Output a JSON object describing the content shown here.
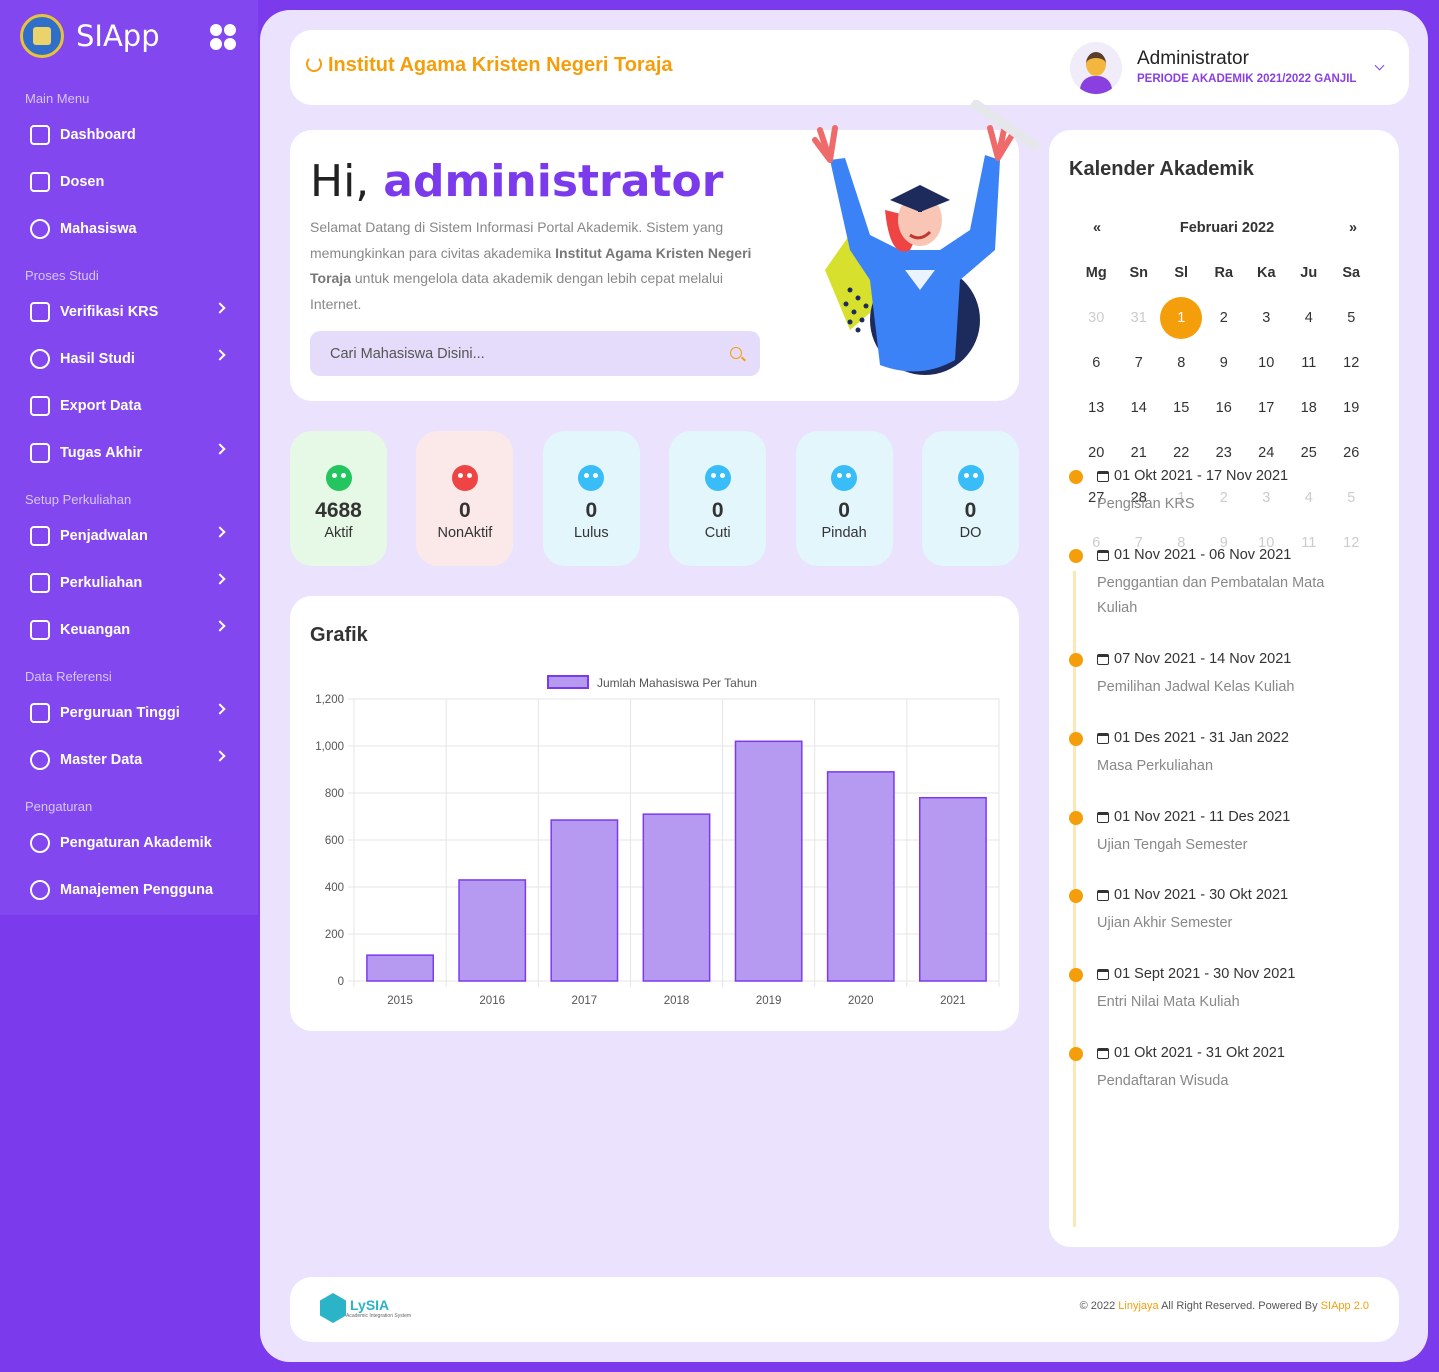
{
  "brand": {
    "name": "SIApp"
  },
  "sidebar": {
    "sections": [
      {
        "label": "Main Menu",
        "items": [
          {
            "label": "Dashboard",
            "arrow": false,
            "icon": "grid-icon"
          },
          {
            "label": "Dosen",
            "arrow": false,
            "icon": "id-card-icon"
          },
          {
            "label": "Mahasiswa",
            "arrow": false,
            "icon": "users-icon"
          }
        ]
      },
      {
        "label": "Proses Studi",
        "items": [
          {
            "label": "Verifikasi KRS",
            "arrow": true,
            "icon": "clipboard-icon"
          },
          {
            "label": "Hasil Studi",
            "arrow": true,
            "icon": "award-icon"
          },
          {
            "label": "Export Data",
            "arrow": false,
            "icon": "excel-icon"
          },
          {
            "label": "Tugas Akhir",
            "arrow": true,
            "icon": "document-icon"
          }
        ]
      },
      {
        "label": "Setup Perkuliahan",
        "items": [
          {
            "label": "Penjadwalan",
            "arrow": true,
            "icon": "calendar-icon"
          },
          {
            "label": "Perkuliahan",
            "arrow": true,
            "icon": "pencil-icon"
          },
          {
            "label": "Keuangan",
            "arrow": true,
            "icon": "wallet-icon"
          }
        ]
      },
      {
        "label": "Data Referensi",
        "items": [
          {
            "label": "Perguruan Tinggi",
            "arrow": true,
            "icon": "building-icon"
          },
          {
            "label": "Master Data",
            "arrow": true,
            "icon": "database-icon"
          }
        ]
      },
      {
        "label": "Pengaturan",
        "items": [
          {
            "label": "Pengaturan Akademik",
            "arrow": false,
            "icon": "gear-icon"
          },
          {
            "label": "Manajemen Pengguna",
            "arrow": false,
            "icon": "user-gear-icon"
          }
        ]
      }
    ]
  },
  "header": {
    "institution": "Institut Agama Kristen Negeri Toraja",
    "user_name": "Administrator",
    "period": "PERIODE AKADEMIK 2021/2022 GANJIL"
  },
  "welcome": {
    "greeting": "Hi, ",
    "name": "administrator",
    "intro_1": "Selamat Datang di Sistem Informasi Portal Akademik. Sistem yang memungkinkan para civitas akademika ",
    "intro_bold": "Institut Agama Kristen Negeri Toraja",
    "intro_2": " untuk mengelola data akademik dengan lebih cepat melalui Internet.",
    "search_placeholder": "Cari Mahasiswa Disini..."
  },
  "stats": [
    {
      "value": "4688",
      "label": "Aktif",
      "bg": "#e6f8e6",
      "icon_color": "#22c55e"
    },
    {
      "value": "0",
      "label": "NonAktif",
      "bg": "#fbe9ea",
      "icon_color": "#ef4444"
    },
    {
      "value": "0",
      "label": "Lulus",
      "bg": "#e3f6fc",
      "icon_color": "#38bdf8"
    },
    {
      "value": "0",
      "label": "Cuti",
      "bg": "#e3f6fc",
      "icon_color": "#38bdf8"
    },
    {
      "value": "0",
      "label": "Pindah",
      "bg": "#e3f6fc",
      "icon_color": "#38bdf8"
    },
    {
      "value": "0",
      "label": "DO",
      "bg": "#e3f6fc",
      "icon_color": "#38bdf8"
    }
  ],
  "grafik": {
    "title": "Grafik"
  },
  "chart_data": {
    "type": "bar",
    "categories": [
      "2015",
      "2016",
      "2017",
      "2018",
      "2019",
      "2020",
      "2021"
    ],
    "series": [
      {
        "name": "Jumlah Mahasiswa Per Tahun",
        "values": [
          110,
          430,
          685,
          710,
          1020,
          890,
          780
        ]
      }
    ],
    "ylim": [
      0,
      1200
    ],
    "yticks": [
      "0",
      "200",
      "400",
      "600",
      "800",
      "1,000",
      "1,200"
    ],
    "grid": true,
    "legend": "top-center",
    "bar_fill": "#b69af2",
    "bar_border": "#7c3aed"
  },
  "calendar": {
    "title": "Kalender Akademik",
    "prev": "«",
    "next": "»",
    "month": "Februari 2022",
    "days_of_week": [
      "Mg",
      "Sn",
      "Sl",
      "Ra",
      "Ka",
      "Ju",
      "Sa"
    ],
    "weeks": [
      [
        "30",
        "31",
        "1",
        "2",
        "3",
        "4",
        "5"
      ],
      [
        "6",
        "7",
        "8",
        "9",
        "10",
        "11",
        "12"
      ],
      [
        "13",
        "14",
        "15",
        "16",
        "17",
        "18",
        "19"
      ],
      [
        "20",
        "21",
        "22",
        "23",
        "24",
        "25",
        "26"
      ],
      [
        "27",
        "28",
        "1",
        "2",
        "3",
        "4",
        "5"
      ],
      [
        "6",
        "7",
        "8",
        "9",
        "10",
        "11",
        "12"
      ]
    ],
    "today": "1"
  },
  "events": [
    {
      "date": "01 Okt 2021 - 17 Nov 2021",
      "desc": "Pengisian KRS"
    },
    {
      "date": "01 Nov 2021 - 06 Nov 2021",
      "desc": "Penggantian dan Pembatalan Mata Kuliah"
    },
    {
      "date": "07 Nov 2021 - 14 Nov 2021",
      "desc": "Pemilihan Jadwal Kelas Kuliah"
    },
    {
      "date": "01 Des 2021 - 31 Jan 2022",
      "desc": "Masa Perkuliahan"
    },
    {
      "date": "01 Nov 2021 - 11 Des 2021",
      "desc": "Ujian Tengah Semester"
    },
    {
      "date": "01 Nov 2021 - 30 Okt 2021",
      "desc": "Ujian Akhir Semester"
    },
    {
      "date": "01 Sept 2021 - 30 Nov 2021",
      "desc": "Entri Nilai Mata Kuliah"
    },
    {
      "date": "01 Okt 2021 - 31 Okt 2021",
      "desc": "Pendaftaran Wisuda"
    }
  ],
  "footer": {
    "logo_text": "LySIA",
    "logo_sub": "Academic Integration System",
    "copy_1": "© 2022 ",
    "company": "Linyjaya",
    "copy_2": " All Right Reserved. Powered By ",
    "product": "SIApp 2.0"
  }
}
